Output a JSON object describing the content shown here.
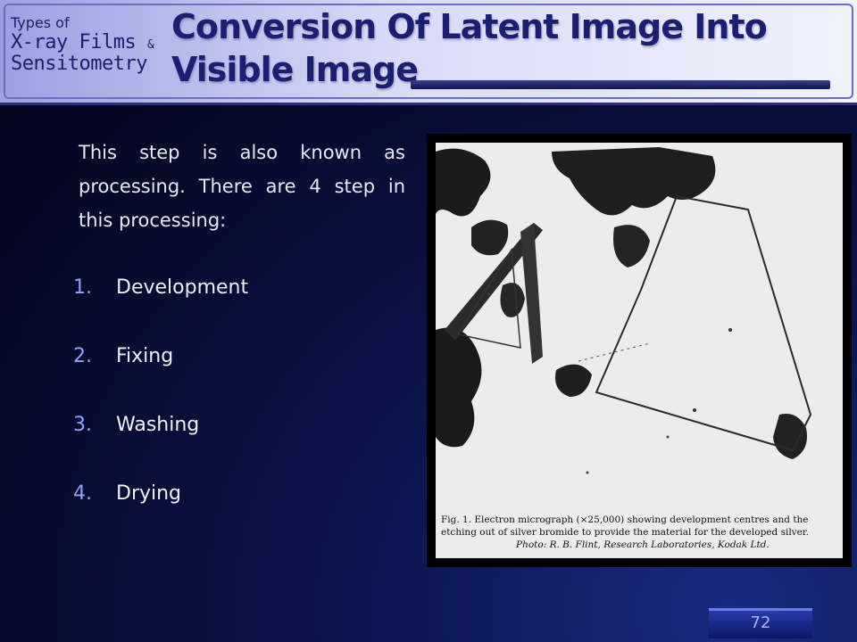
{
  "header": {
    "subject_line1": "Types of",
    "subject_line2": "X-ray Films",
    "subject_amp": "&",
    "subject_line3": "Sensitometry",
    "title": "Conversion Of Latent Image Into Visible Image"
  },
  "intro": "This step is also known as processing. There are 4 step in this processing:",
  "steps": [
    {
      "num": "1.",
      "label": "Development"
    },
    {
      "num": "2.",
      "label": "Fixing"
    },
    {
      "num": "3.",
      "label": "Washing"
    },
    {
      "num": "4.",
      "label": "Drying"
    }
  ],
  "figure": {
    "caption_line1": "Fig. 1. Electron micrograph (×25,000) showing development centres and the",
    "caption_line2": "etching out of silver bromide to provide the material for the developed silver.",
    "caption_line3": "Photo: R. B. Flint, Research Laboratories, Kodak Ltd."
  },
  "page_number": "72",
  "colors": {
    "header_text": "#1c1f70",
    "list_number": "#8fa0ff",
    "body_text": "#e8e8f4"
  }
}
